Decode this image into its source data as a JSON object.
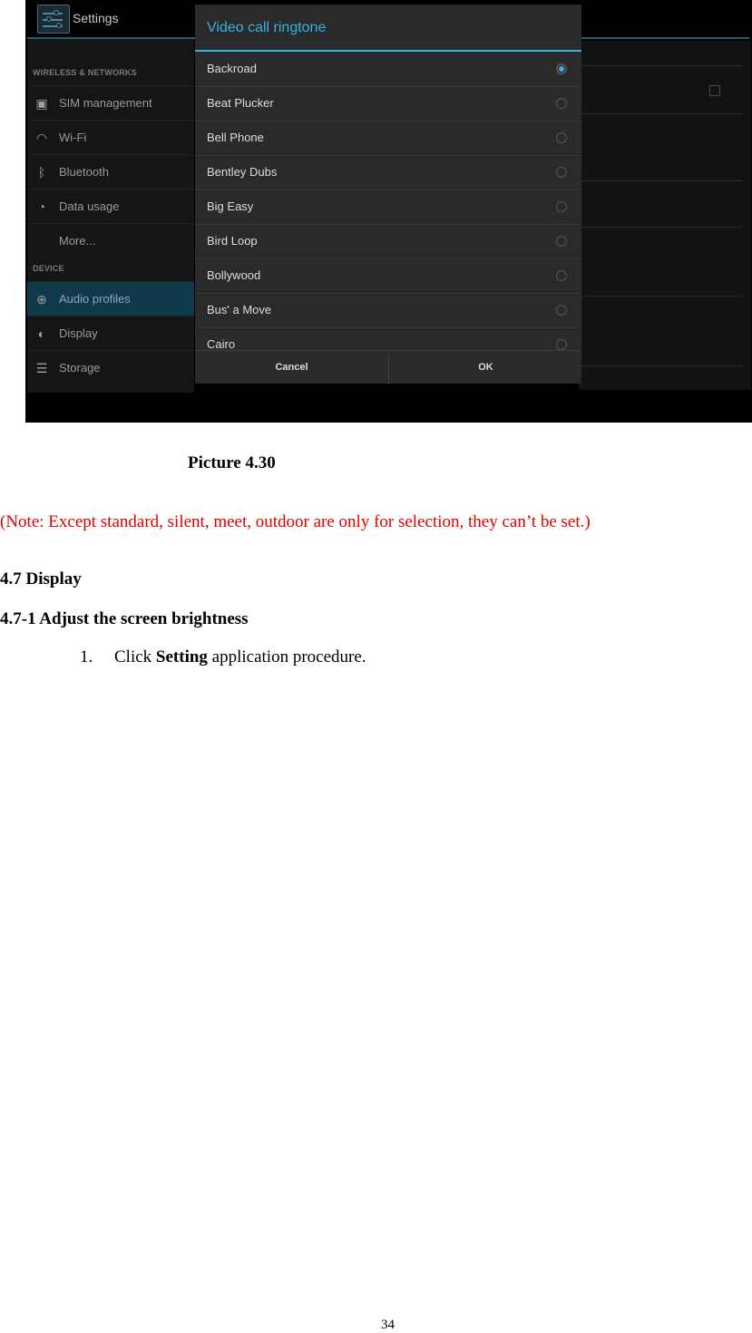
{
  "screenshot": {
    "app_title": "Settings",
    "sidebar": {
      "sections": [
        {
          "header": "WIRELESS & NETWORKS"
        },
        {
          "header": "DEVICE"
        }
      ],
      "items": [
        {
          "label": "SIM management",
          "icon": "sim-icon",
          "active": false
        },
        {
          "label": "Wi-Fi",
          "icon": "wifi-icon",
          "active": false
        },
        {
          "label": "Bluetooth",
          "icon": "bluetooth-icon",
          "active": false
        },
        {
          "label": "Data usage",
          "icon": "data-usage-icon",
          "active": false
        },
        {
          "label": "More...",
          "icon": "",
          "active": false
        },
        {
          "label": "Audio profiles",
          "icon": "audio-profiles-icon",
          "active": true
        },
        {
          "label": "Display",
          "icon": "display-icon",
          "active": false
        },
        {
          "label": "Storage",
          "icon": "storage-icon",
          "active": false
        }
      ]
    },
    "dialog": {
      "title": "Video call ringtone",
      "options": [
        {
          "label": "Backroad",
          "selected": true
        },
        {
          "label": "Beat Plucker",
          "selected": false
        },
        {
          "label": "Bell Phone",
          "selected": false
        },
        {
          "label": "Bentley Dubs",
          "selected": false
        },
        {
          "label": "Big Easy",
          "selected": false
        },
        {
          "label": "Bird Loop",
          "selected": false
        },
        {
          "label": "Bollywood",
          "selected": false
        },
        {
          "label": "Bus' a Move",
          "selected": false
        },
        {
          "label": "Cairo",
          "selected": false
        }
      ],
      "cancel_label": "Cancel",
      "ok_label": "OK"
    },
    "colors": {
      "accent": "#33b5e5",
      "active_item": "#0f3a4c"
    }
  },
  "caption": "Picture 4.30",
  "note": "(Note: Except standard, silent, meet, outdoor are only for selection, they can’t be set.)",
  "section_heading": "4.7 Display",
  "subsection_heading": "4.7-1 Adjust the screen brightness",
  "steps": [
    {
      "number": "1.",
      "prefix": "Click ",
      "bold": "Setting",
      "suffix": " application procedure."
    }
  ],
  "page_number": "34"
}
